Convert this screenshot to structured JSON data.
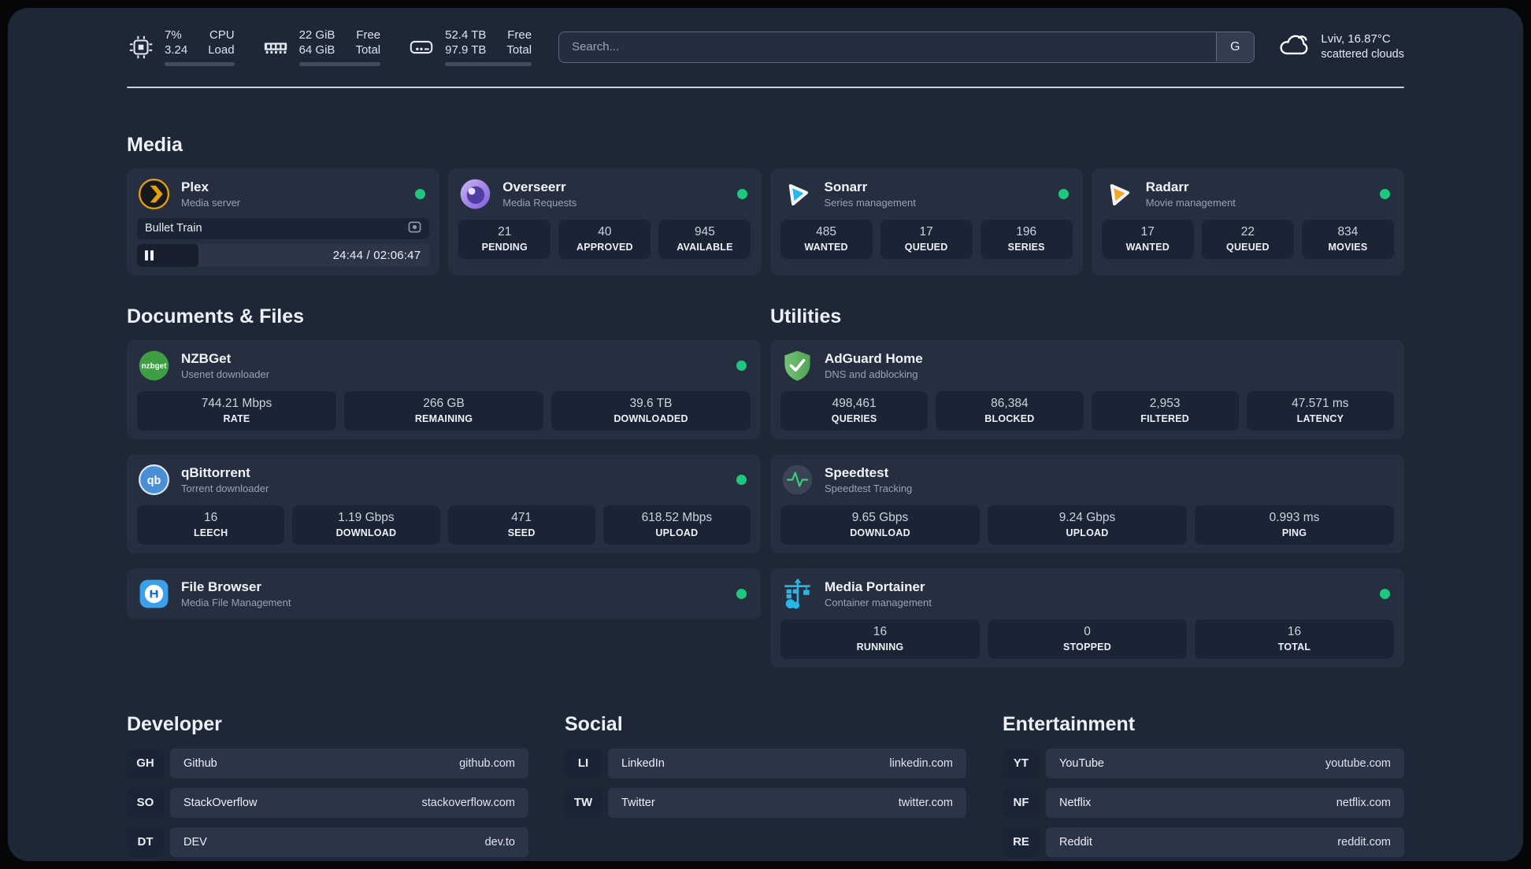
{
  "topbar": {
    "stats": [
      {
        "icon": "cpu-icon",
        "line1": "7%",
        "line2": "3.24",
        "label1": "CPU",
        "label2": "Load",
        "progress_pct": 7
      },
      {
        "icon": "memory-icon",
        "line1": "22 GiB",
        "line2": "64 GiB",
        "label1": "Free",
        "label2": "Total",
        "progress_pct": 66
      },
      {
        "icon": "disk-icon",
        "line1": "52.4 TB",
        "line2": "97.9 TB",
        "label1": "Free",
        "label2": "Total",
        "progress_pct": 46
      }
    ],
    "search": {
      "placeholder": "Search...",
      "engine_button": "G"
    },
    "weather": {
      "location": "Lviv, 16.87°C",
      "condition": "scattered clouds"
    }
  },
  "sections": {
    "media": {
      "title": "Media",
      "plex": {
        "name": "Plex",
        "desc": "Media server",
        "status": "online",
        "now_playing": {
          "title": "Bullet Train",
          "time_display": "24:44 / 02:06:47",
          "progress_pct": 21
        }
      },
      "overseerr": {
        "name": "Overseerr",
        "desc": "Media Requests",
        "status": "online",
        "stats": [
          {
            "value": "21",
            "label": "PENDING"
          },
          {
            "value": "40",
            "label": "APPROVED"
          },
          {
            "value": "945",
            "label": "AVAILABLE"
          }
        ]
      },
      "sonarr": {
        "name": "Sonarr",
        "desc": "Series management",
        "status": "online",
        "stats": [
          {
            "value": "485",
            "label": "WANTED"
          },
          {
            "value": "17",
            "label": "QUEUED"
          },
          {
            "value": "196",
            "label": "SERIES"
          }
        ]
      },
      "radarr": {
        "name": "Radarr",
        "desc": "Movie management",
        "status": "online",
        "stats": [
          {
            "value": "17",
            "label": "WANTED"
          },
          {
            "value": "22",
            "label": "QUEUED"
          },
          {
            "value": "834",
            "label": "MOVIES"
          }
        ]
      }
    },
    "documents": {
      "title": "Documents & Files",
      "nzbget": {
        "name": "NZBGet",
        "desc": "Usenet downloader",
        "status": "online",
        "stats": [
          {
            "value": "744.21 Mbps",
            "label": "RATE"
          },
          {
            "value": "266 GB",
            "label": "REMAINING"
          },
          {
            "value": "39.6 TB",
            "label": "DOWNLOADED"
          }
        ]
      },
      "qbittorrent": {
        "name": "qBittorrent",
        "desc": "Torrent downloader",
        "status": "online",
        "stats": [
          {
            "value": "16",
            "label": "LEECH"
          },
          {
            "value": "1.19 Gbps",
            "label": "DOWNLOAD"
          },
          {
            "value": "471",
            "label": "SEED"
          },
          {
            "value": "618.52 Mbps",
            "label": "UPLOAD"
          }
        ]
      },
      "filebrowser": {
        "name": "File Browser",
        "desc": "Media File Management",
        "status": "online"
      }
    },
    "utilities": {
      "title": "Utilities",
      "adguard": {
        "name": "AdGuard Home",
        "desc": "DNS and adblocking",
        "stats": [
          {
            "value": "498,461",
            "label": "QUERIES"
          },
          {
            "value": "86,384",
            "label": "BLOCKED"
          },
          {
            "value": "2,953",
            "label": "FILTERED"
          },
          {
            "value": "47.571 ms",
            "label": "LATENCY"
          }
        ]
      },
      "speedtest": {
        "name": "Speedtest",
        "desc": "Speedtest Tracking",
        "stats": [
          {
            "value": "9.65 Gbps",
            "label": "DOWNLOAD"
          },
          {
            "value": "9.24 Gbps",
            "label": "UPLOAD"
          },
          {
            "value": "0.993 ms",
            "label": "PING"
          }
        ]
      },
      "portainer": {
        "name": "Media Portainer",
        "desc": "Container management",
        "status": "online",
        "stats": [
          {
            "value": "16",
            "label": "RUNNING"
          },
          {
            "value": "0",
            "label": "STOPPED"
          },
          {
            "value": "16",
            "label": "TOTAL"
          }
        ]
      }
    },
    "bookmarks": [
      {
        "title": "Developer",
        "links": [
          {
            "abbr": "GH",
            "name": "Github",
            "url": "github.com"
          },
          {
            "abbr": "SO",
            "name": "StackOverflow",
            "url": "stackoverflow.com"
          },
          {
            "abbr": "DT",
            "name": "DEV",
            "url": "dev.to"
          }
        ]
      },
      {
        "title": "Social",
        "links": [
          {
            "abbr": "LI",
            "name": "LinkedIn",
            "url": "linkedin.com"
          },
          {
            "abbr": "TW",
            "name": "Twitter",
            "url": "twitter.com"
          }
        ]
      },
      {
        "title": "Entertainment",
        "links": [
          {
            "abbr": "YT",
            "name": "YouTube",
            "url": "youtube.com"
          },
          {
            "abbr": "NF",
            "name": "Netflix",
            "url": "netflix.com"
          },
          {
            "abbr": "RE",
            "name": "Reddit",
            "url": "reddit.com"
          }
        ]
      }
    ]
  }
}
